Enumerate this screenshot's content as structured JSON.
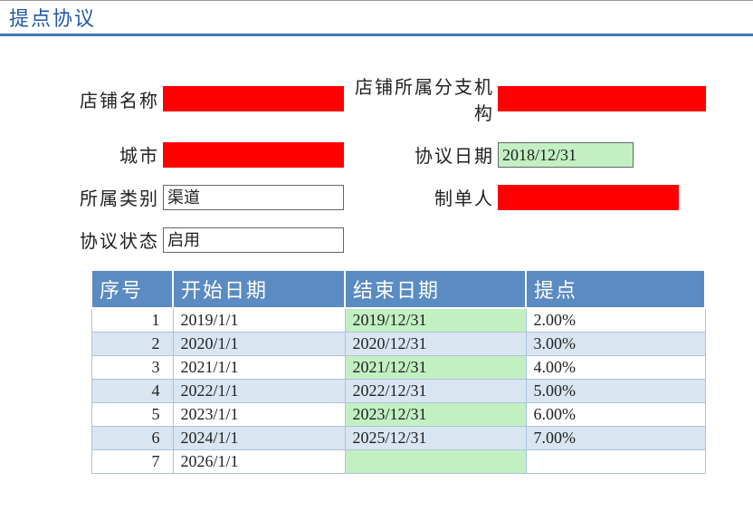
{
  "title": "提点协议",
  "form": {
    "store_name_label": "店铺名称",
    "store_name_value": "",
    "branch_label": "店铺所属分支机构",
    "branch_value": "",
    "city_label": "城市",
    "city_value": "",
    "agreement_date_label": "协议日期",
    "agreement_date_value": "2018/12/31",
    "category_label": "所属类别",
    "category_value": "渠道",
    "creator_label": "制单人",
    "creator_value": "",
    "status_label": "协议状态",
    "status_value": "启用"
  },
  "table": {
    "headers": {
      "seq": "序号",
      "start": "开始日期",
      "end": "结束日期",
      "rate": "提点"
    },
    "rows": [
      {
        "seq": "1",
        "start": "2019/1/1",
        "end": "2019/12/31",
        "rate": "2.00%",
        "end_green": true
      },
      {
        "seq": "2",
        "start": "2020/1/1",
        "end": "2020/12/31",
        "rate": "3.00%",
        "end_green": false
      },
      {
        "seq": "3",
        "start": "2021/1/1",
        "end": "2021/12/31",
        "rate": "4.00%",
        "end_green": true
      },
      {
        "seq": "4",
        "start": "2022/1/1",
        "end": "2022/12/31",
        "rate": "5.00%",
        "end_green": false
      },
      {
        "seq": "5",
        "start": "2023/1/1",
        "end": "2023/12/31",
        "rate": "6.00%",
        "end_green": true
      },
      {
        "seq": "6",
        "start": "2024/1/1",
        "end": "2025/12/31",
        "rate": "7.00%",
        "end_green": false
      },
      {
        "seq": "7",
        "start": "2026/1/1",
        "end": "",
        "rate": "",
        "end_green": true
      }
    ]
  }
}
